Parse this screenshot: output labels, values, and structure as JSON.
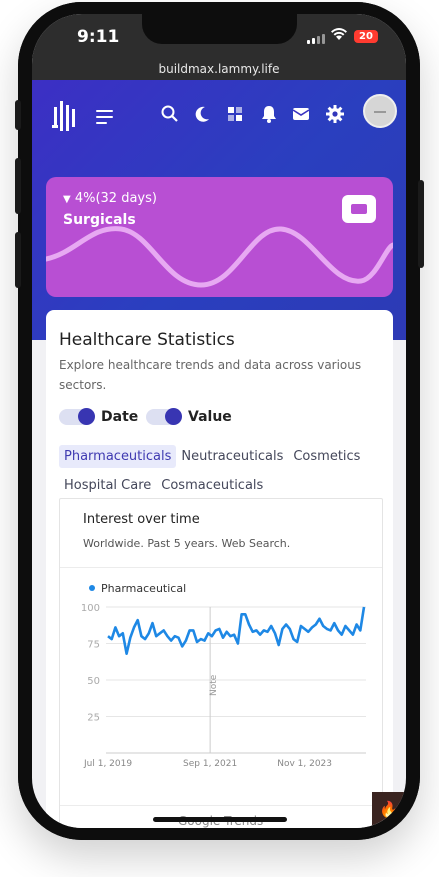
{
  "status_bar": {
    "time": "9:11",
    "battery": "20"
  },
  "browser": {
    "url": "buildmax.lammy.life"
  },
  "header_icons": [
    "logo-icon",
    "menu-icon",
    "search-icon",
    "moon-icon",
    "apps-icon",
    "bell-icon",
    "mail-icon",
    "gear-icon",
    "avatar"
  ],
  "promo": {
    "change": "4%(32 days)",
    "title": "Surgicals",
    "icon": "printer-icon"
  },
  "card": {
    "title": "Healthcare Statistics",
    "description": "Explore healthcare trends and data across various sectors.",
    "toggles": [
      {
        "label": "Date",
        "on": true
      },
      {
        "label": "Value",
        "on": true
      }
    ],
    "tabs": [
      {
        "label": "Pharmaceuticals",
        "active": true
      },
      {
        "label": "Neutraceuticals",
        "active": false
      },
      {
        "label": "Cosmetics",
        "active": false
      },
      {
        "label": "Hospital Care",
        "active": false
      },
      {
        "label": "Cosmaceuticals",
        "active": false
      }
    ]
  },
  "chart_panel": {
    "title": "Interest over time",
    "subtitle": "Worldwide. Past 5 years. Web Search.",
    "footer": "Google Trends"
  },
  "chart_data": {
    "type": "line",
    "series": [
      {
        "name": "Pharmaceutical",
        "color": "#1e88e5",
        "values": [
          80,
          78,
          86,
          80,
          82,
          68,
          79,
          86,
          91,
          80,
          78,
          82,
          89,
          80,
          82,
          84,
          80,
          77,
          80,
          79,
          73,
          77,
          84,
          84,
          76,
          78,
          77,
          82,
          80,
          84,
          85,
          79,
          83,
          80,
          81,
          75,
          95,
          95,
          88,
          83,
          84,
          81,
          84,
          83,
          87,
          82,
          74,
          85,
          88,
          85,
          78,
          76,
          87,
          85,
          83,
          86,
          88,
          92,
          87,
          85,
          84,
          89,
          84,
          81,
          87,
          84,
          81,
          88,
          84,
          100
        ]
      }
    ],
    "x_start": "Jul 1, 2019",
    "x_end": "Dec 1, 2024",
    "x_tick_labels": [
      "Jul 1, 2019",
      "Sep 1, 2021",
      "Nov 1, 2023"
    ],
    "y_ticks": [
      25,
      50,
      75,
      100
    ],
    "ylim": [
      0,
      100
    ],
    "annotation": "Note",
    "grid": true,
    "legend": "top-left"
  }
}
